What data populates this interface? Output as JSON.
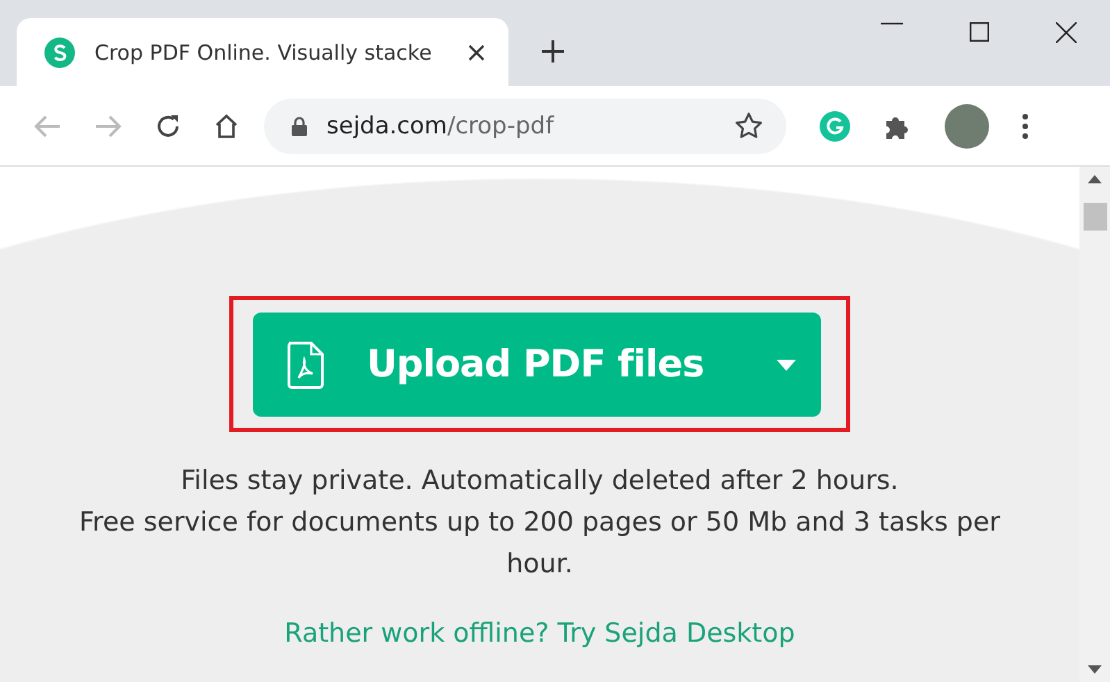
{
  "window": {
    "tab": {
      "title": "Crop PDF Online. Visually stacke",
      "selected": true
    },
    "address": {
      "domain": "sejda.com",
      "path": "/crop-pdf"
    }
  },
  "upload_button": {
    "label": "Upload PDF files",
    "highlighted": true
  },
  "notes": [
    "Files stay private. Automatically deleted after 2 hours.",
    "Free service for documents up to 200 pages or 50 Mb and 3 tasks per hour."
  ],
  "desktop_link": "Rather work offline? Try Sejda Desktop"
}
